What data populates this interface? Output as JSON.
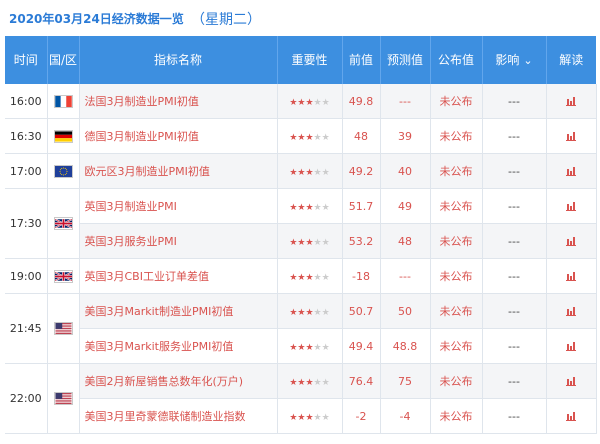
{
  "title": {
    "date": "2020年03月24日经济数据一览",
    "weekday": "（星期二）"
  },
  "headers": {
    "time": "时间",
    "country": "国/区",
    "indicator": "指标名称",
    "importance": "重要性",
    "previous": "前值",
    "forecast": "预测值",
    "actual": "公布值",
    "effect": "影响",
    "interpret": "解读"
  },
  "colors": {
    "header": "#3d8fe0",
    "accent": "#d9534f",
    "title": "#2b7bd6"
  },
  "rows": [
    {
      "time": "16:00",
      "flag": "france-flag",
      "name": "法国3月制造业PMI初值",
      "stars": 3,
      "previous": "49.8",
      "forecast": "---",
      "actual": "未公布",
      "effect": "---"
    },
    {
      "time": "16:30",
      "flag": "germany-flag",
      "name": "德国3月制造业PMI初值",
      "stars": 3,
      "previous": "48",
      "forecast": "39",
      "actual": "未公布",
      "effect": "---"
    },
    {
      "time": "17:00",
      "flag": "eu-flag",
      "name": "欧元区3月制造业PMI初值",
      "stars": 3,
      "previous": "49.2",
      "forecast": "40",
      "actual": "未公布",
      "effect": "---"
    },
    {
      "time": "17:30",
      "flag": "uk-flag",
      "name": "英国3月制造业PMI",
      "stars": 3,
      "previous": "51.7",
      "forecast": "49",
      "actual": "未公布",
      "effect": "---"
    },
    {
      "time": "",
      "flag": "",
      "name": "英国3月服务业PMI",
      "stars": 3,
      "previous": "53.2",
      "forecast": "48",
      "actual": "未公布",
      "effect": "---"
    },
    {
      "time": "19:00",
      "flag": "uk-flag",
      "name": "英国3月CBI工业订单差值",
      "stars": 3,
      "previous": "-18",
      "forecast": "---",
      "actual": "未公布",
      "effect": "---"
    },
    {
      "time": "21:45",
      "flag": "us-flag",
      "name": "美国3月Markit制造业PMI初值",
      "stars": 3,
      "previous": "50.7",
      "forecast": "50",
      "actual": "未公布",
      "effect": "---"
    },
    {
      "time": "",
      "flag": "",
      "name": "美国3月Markit服务业PMI初值",
      "stars": 3,
      "previous": "49.4",
      "forecast": "48.8",
      "actual": "未公布",
      "effect": "---"
    },
    {
      "time": "22:00",
      "flag": "us-flag",
      "name": "美国2月新屋销售总数年化(万户)",
      "stars": 3,
      "previous": "76.4",
      "forecast": "75",
      "actual": "未公布",
      "effect": "---"
    },
    {
      "time": "",
      "flag": "",
      "name": "美国3月里奇蒙德联储制造业指数",
      "stars": 3,
      "previous": "-2",
      "forecast": "-4",
      "actual": "未公布",
      "effect": "---"
    }
  ],
  "groups": [
    {
      "start": 0,
      "span": 1
    },
    {
      "start": 1,
      "span": 1
    },
    {
      "start": 2,
      "span": 1
    },
    {
      "start": 3,
      "span": 2
    },
    {
      "start": 5,
      "span": 1
    },
    {
      "start": 6,
      "span": 2
    },
    {
      "start": 8,
      "span": 2
    }
  ]
}
